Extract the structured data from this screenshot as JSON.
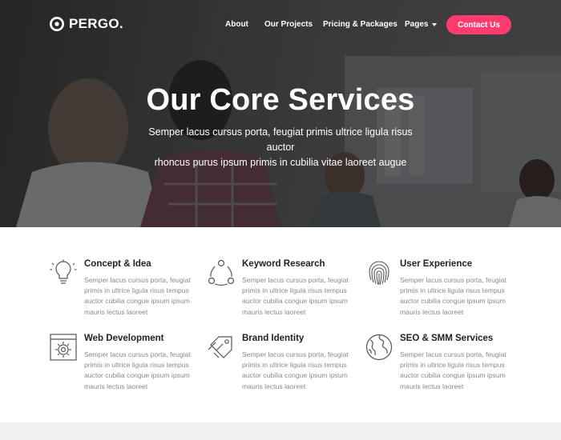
{
  "brand": {
    "name": "PERGO."
  },
  "nav": {
    "items": [
      {
        "label": "About"
      },
      {
        "label": "Our Projects"
      },
      {
        "label": "Pricing & Packages"
      },
      {
        "label": "Pages"
      }
    ],
    "cta_label": "Contact Us"
  },
  "hero": {
    "title": "Our Core Services",
    "subtitle_line1": "Semper lacus cursus porta, feugiat primis ultrice ligula risus auctor",
    "subtitle_line2": "rhoncus purus ipsum primis in cubilia vitae laoreet augue"
  },
  "services": [
    {
      "icon": "lightbulb-icon",
      "title": "Concept & Idea",
      "text": "Semper lacus cursus porta, feugiat primis in ultrice ligula risus tempus auctor cubilia congue ipsum ipsum mauris lectus laoreet"
    },
    {
      "icon": "network-icon",
      "title": "Keyword Research",
      "text": "Semper lacus cursus porta, feugiat primis in ultrice ligula risus tempus auctor cubilia congue ipsum ipsum mauris lectus laoreet"
    },
    {
      "icon": "fingerprint-icon",
      "title": "User Experience",
      "text": "Semper lacus cursus porta, feugiat primis in ultrice ligula risus tempus auctor cubilia congue ipsum ipsum mauris lectus laoreet"
    },
    {
      "icon": "gear-window-icon",
      "title": "Web Development",
      "text": "Semper lacus cursus porta, feugiat primis in ultrice ligula risus tempus auctor cubilia congue ipsum ipsum mauris lectus laoreet"
    },
    {
      "icon": "tag-icon",
      "title": "Brand Identity",
      "text": "Semper lacus cursus porta, feugiat primis in ultrice ligula risus tempus auctor cubilia congue ipsum ipsum mauris lectus laoreet"
    },
    {
      "icon": "globe-icon",
      "title": "SEO & SMM Services",
      "text": "Semper lacus cursus porta, feugiat primis in ultrice ligula risus tempus auctor cubilia congue ipsum ipsum mauris lectus laoreet"
    }
  ],
  "colors": {
    "accent": "#ff3b70",
    "heading": "#222222",
    "body_text": "#8a8a8a"
  }
}
